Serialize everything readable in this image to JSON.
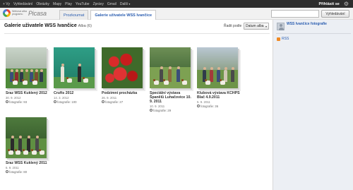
{
  "gbar": {
    "items": [
      "+ Vy",
      "Vyhledávání",
      "Obrázky",
      "Mapy",
      "Play",
      "YouTube",
      "Zprávy",
      "Gmail",
      "Další"
    ],
    "signin": "Přihlásit se"
  },
  "header": {
    "logo_sub": "Webová alba programu",
    "logo_text": "Picasa",
    "tabs": [
      "Prozkoumat",
      "Galerie uživatele WSS Ivančice"
    ],
    "search_placeholder": "",
    "search_button": "Vyhledávání"
  },
  "main": {
    "title": "Galerie uživatele WSS Ivančice",
    "count": "Alba (6)",
    "sort_label": "Řadit podle",
    "sort_value": "Datum alba",
    "albums": [
      {
        "title": "Sraz WSS Kuklený 2012",
        "date": "30. 9. 2012",
        "photos": "fotografie: 93"
      },
      {
        "title": "Crufts 2012",
        "date": "14. 3. 2012",
        "photos": "fotografie: 100"
      },
      {
        "title": "Podzimní procházka",
        "date": "26. 9. 2011",
        "photos": "fotografie: 27"
      },
      {
        "title": "Speciální výstava Španělů Luhačovice 10. 9. 2011",
        "date": "10. 9. 2011",
        "photos": "fotografie: 29"
      },
      {
        "title": "Klubová výstava KCHPS Blač 4.9.2011",
        "date": "5. 9. 2011",
        "photos": "fotografie: 36"
      },
      {
        "title": "Sraz WSS Kuklený 2011",
        "date": "6. 9. 2011",
        "photos": "fotografie: 80"
      }
    ]
  },
  "sidebar": {
    "owner": "WSS Ivančice fotografie",
    "rss": "RSS"
  },
  "colors": {
    "gbar_bg": "#2d2d2d",
    "link": "#2a5db0",
    "sidebar_bg": "#eceff4"
  }
}
